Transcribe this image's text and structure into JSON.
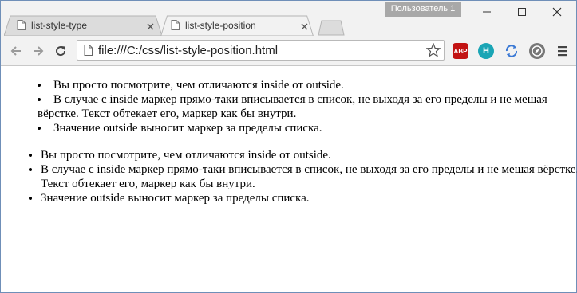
{
  "window": {
    "profile_label": "Пользователь 1"
  },
  "tabs": [
    {
      "title": "list-style-type",
      "active": false
    },
    {
      "title": "list-style-position",
      "active": true
    }
  ],
  "toolbar": {
    "url": "file:///C:/css/list-style-position.html"
  },
  "extensions": [
    {
      "name": "abp-icon",
      "label": "ABP",
      "color": "#c21313"
    },
    {
      "name": "hola-icon",
      "label": "H",
      "color": "#1aa5b5"
    },
    {
      "name": "sync-icon",
      "label": "",
      "color": "#3a78d4"
    },
    {
      "name": "compass-icon",
      "label": "",
      "color": "#777777"
    }
  ],
  "content": {
    "inside_list": [
      "Вы просто посмотрите, чем отличаются inside от outside.",
      "В случае с inside маркер прямо-таки вписывается в список, не выходя за его пределы и не мешая вёрстке. Текст обтекает его, маркер как бы внутри.",
      "Значение outside выносит маркер за пределы списка."
    ],
    "outside_list": [
      "Вы просто посмотрите, чем отличаются inside от outside.",
      "В случае с inside маркер прямо-таки вписывается в список, не выходя за его пределы и не мешая вёрстке. Текст обтекает его, маркер как бы внутри.",
      "Значение outside выносит маркер за пределы списка."
    ]
  }
}
